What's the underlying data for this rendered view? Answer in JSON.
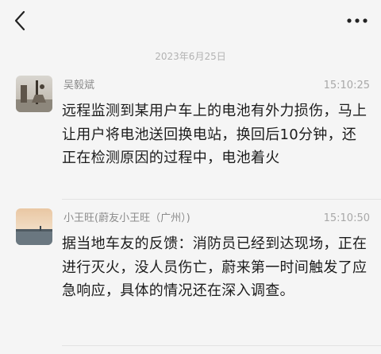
{
  "header": {
    "back_icon": "chevron-left-icon",
    "more_icon": "ellipsis-icon"
  },
  "date_divider": "2023年6月25日",
  "messages": [
    {
      "sender": "吴毅斌",
      "time": "15:10:25",
      "text": "远程监测到某用户车上的电池有外力损伤，马上让用户将电池送回换电站，换回后10分钟，还正在检测原因的过程中，电池着火"
    },
    {
      "sender": "小王旺(蔚友小王旺（广州）)",
      "time": "15:10:50",
      "text": "据当地车友的反馈：消防员已经到达现场，正在进行灭火，没人员伤亡，蔚来第一时间触发了应急响应，具体的情况还在深入调查。"
    }
  ],
  "colors": {
    "background": "#f5f5f5",
    "text": "#1c1c1c",
    "meta": "#a8a8a8"
  }
}
